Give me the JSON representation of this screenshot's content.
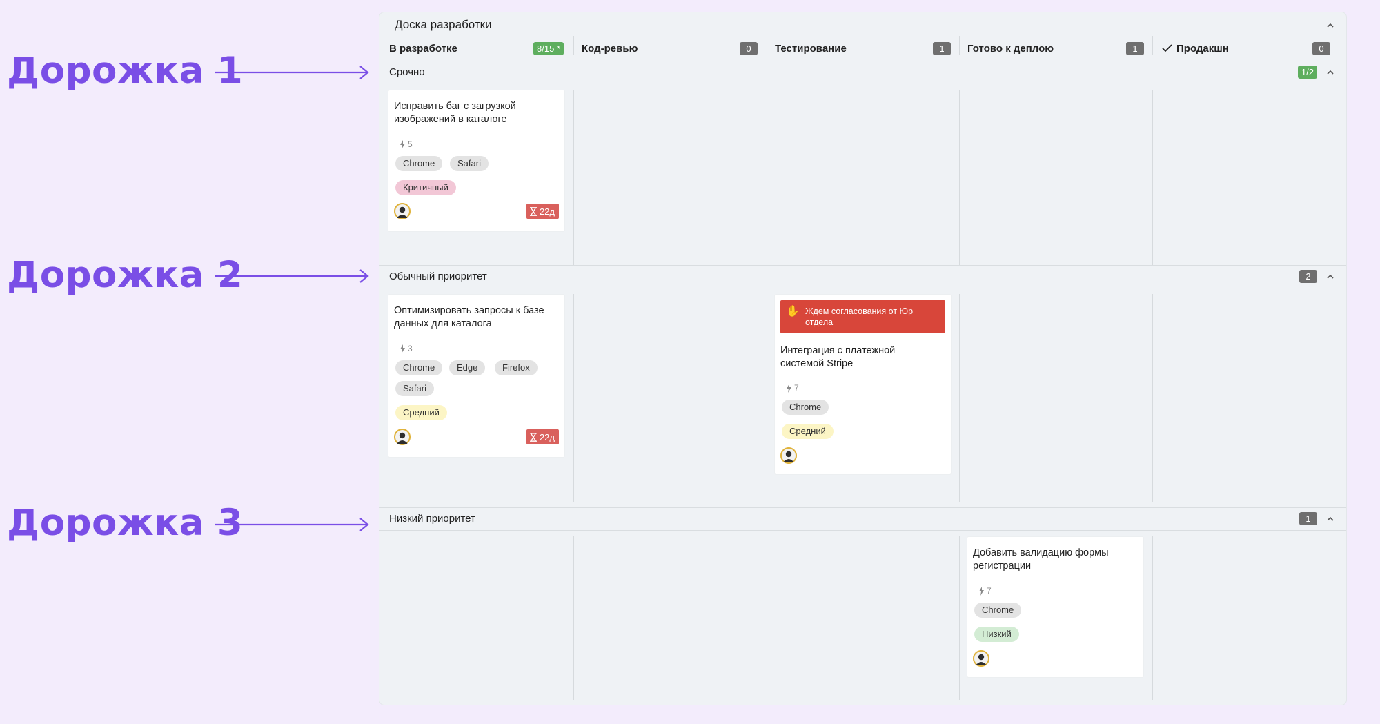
{
  "annotations": {
    "lane1_label": "Дорожка 1",
    "lane2_label": "Дорожка 2",
    "lane3_label": "Дорожка 3",
    "color": "#7a4ee6"
  },
  "board": {
    "title": "Доска разработки",
    "columns": [
      {
        "name": "В разработке",
        "badge": "8/15 *",
        "badge_color": "green"
      },
      {
        "name": "Код-ревью",
        "badge": "0"
      },
      {
        "name": "Тестирование",
        "badge": "1"
      },
      {
        "name": "Готово к деплою",
        "badge": "1"
      },
      {
        "name": "Продакшн",
        "badge": "0",
        "icon": "check-icon"
      }
    ]
  },
  "lanes": [
    {
      "title": "Срочно",
      "badge": "1/2",
      "badge_color": "green",
      "cards": [
        {
          "title": "Исправить баг с загрузкой изображений в каталоге",
          "points": "5",
          "tags": [
            "Chrome",
            "Safari"
          ],
          "priority": "Критичный",
          "age": "22д"
        }
      ]
    },
    {
      "title": "Обычный приоритет",
      "badge": "2",
      "cards": [
        {
          "title": "Оптимизировать запросы к базе данных для каталога",
          "points": "3",
          "tags": [
            "Chrome",
            "Edge",
            "Firefox",
            "Safari"
          ],
          "priority": "Средний",
          "age": "22д"
        },
        {
          "blocker": "Ждем согласования от Юр отдела",
          "title": "Интеграция с платежной системой Stripe",
          "points": "7",
          "tags": [
            "Chrome"
          ],
          "priority": "Средний"
        }
      ]
    },
    {
      "title": "Низкий приоритет",
      "badge": "1",
      "cards": [
        {
          "title": "Добавить валидацию формы регистрации",
          "points": "7",
          "tags": [
            "Chrome"
          ],
          "priority": "Низкий"
        }
      ]
    }
  ]
}
